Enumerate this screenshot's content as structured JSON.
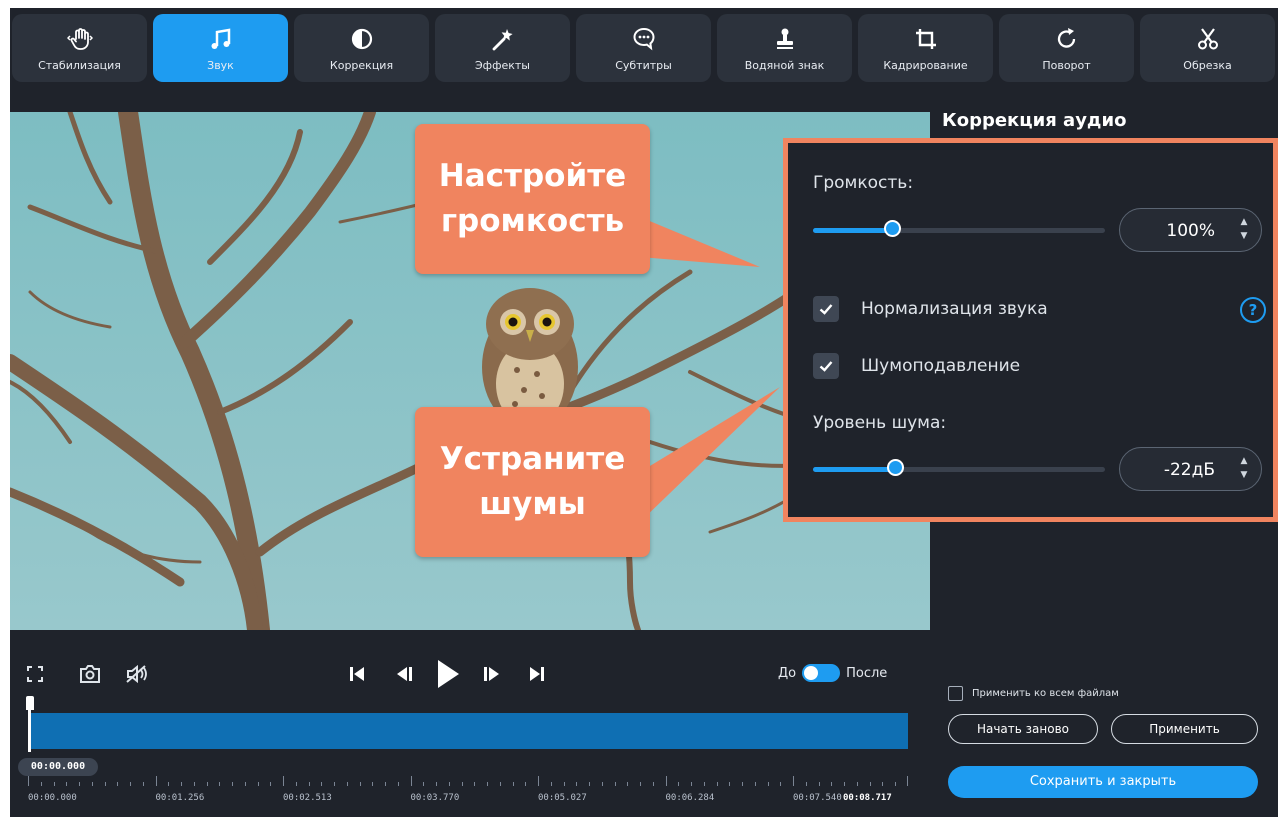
{
  "toolbar": {
    "tools": [
      {
        "label": "Стабилизация",
        "icon": "hand-stabilization-icon"
      },
      {
        "label": "Звук",
        "icon": "music-note-icon",
        "active": true
      },
      {
        "label": "Коррекция",
        "icon": "contrast-icon"
      },
      {
        "label": "Эффекты",
        "icon": "magic-wand-icon"
      },
      {
        "label": "Субтитры",
        "icon": "speech-bubble-icon"
      },
      {
        "label": "Водяной знак",
        "icon": "stamp-icon"
      },
      {
        "label": "Кадрирование",
        "icon": "crop-icon"
      },
      {
        "label": "Поворот",
        "icon": "rotate-icon"
      },
      {
        "label": "Обрезка",
        "icon": "scissors-icon"
      }
    ]
  },
  "callouts": {
    "volume": [
      "Настройте",
      "громкость"
    ],
    "noise": [
      "Устраните",
      "шумы"
    ]
  },
  "audio_panel": {
    "title": "Коррекция аудио",
    "volume_label": "Громкость:",
    "volume_value": "100%",
    "volume_level": 0.27,
    "normalize_label": "Нормализация звука",
    "normalize_checked": true,
    "denoise_label": "Шумоподавление",
    "denoise_checked": true,
    "noise_level_label": "Уровень шума:",
    "noise_value": "-22дБ",
    "noise_level": 0.28,
    "help_glyph": "?"
  },
  "player": {
    "before_label": "До",
    "after_label": "После",
    "current_time": "00:00.000",
    "timeline_labels": [
      "00:00.000",
      "00:01.256",
      "00:02.513",
      "00:03.770",
      "00:05.027",
      "00:06.284",
      "00:07.540"
    ],
    "end_time": "00:08.717"
  },
  "actions": {
    "apply_all_label": "Применить ко всем файлам",
    "reset_label": "Начать заново",
    "apply_label": "Применить",
    "save_label": "Сохранить и закрыть"
  },
  "colors": {
    "accent": "#1e9cf1",
    "callout": "#f0845f",
    "background": "#1f232b"
  }
}
